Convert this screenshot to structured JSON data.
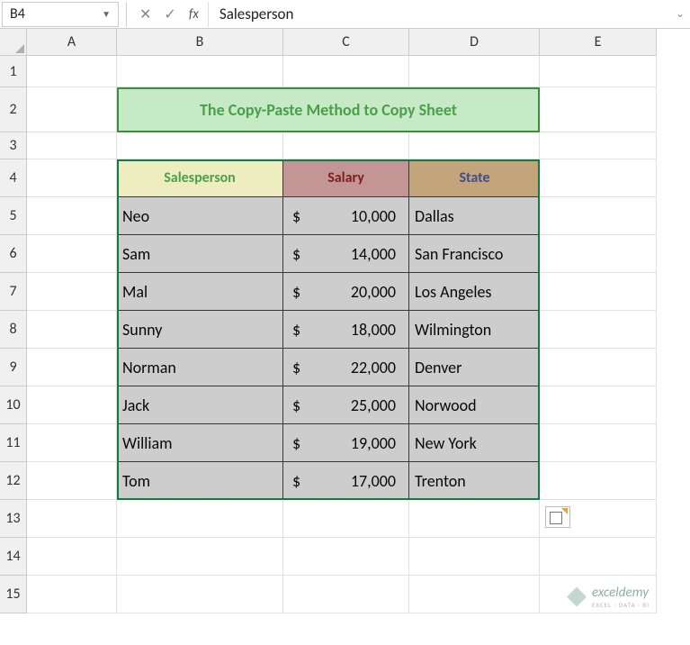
{
  "formula_bar": {
    "name_box": "B4",
    "formula_value": "Salesperson"
  },
  "columns": [
    "A",
    "B",
    "C",
    "D",
    "E"
  ],
  "rows": [
    "1",
    "2",
    "3",
    "4",
    "5",
    "6",
    "7",
    "8",
    "9",
    "10",
    "11",
    "12",
    "13",
    "14",
    "15"
  ],
  "title": "The Copy-Paste Method to Copy Sheet",
  "headers": {
    "salesperson": "Salesperson",
    "salary": "Salary",
    "state": "State"
  },
  "chart_data": {
    "type": "table",
    "columns": [
      "Salesperson",
      "Salary",
      "State"
    ],
    "rows": [
      {
        "salesperson": "Neo",
        "salary": 10000,
        "salary_display": "10,000",
        "state": "Dallas"
      },
      {
        "salesperson": "Sam",
        "salary": 14000,
        "salary_display": "14,000",
        "state": "San Francisco"
      },
      {
        "salesperson": "Mal",
        "salary": 20000,
        "salary_display": "20,000",
        "state": "Los Angeles"
      },
      {
        "salesperson": "Sunny",
        "salary": 18000,
        "salary_display": "18,000",
        "state": "Wilmington"
      },
      {
        "salesperson": "Norman",
        "salary": 22000,
        "salary_display": "22,000",
        "state": "Denver"
      },
      {
        "salesperson": "Jack",
        "salary": 25000,
        "salary_display": "25,000",
        "state": "Norwood"
      },
      {
        "salesperson": "William",
        "salary": 19000,
        "salary_display": "19,000",
        "state": "New York"
      },
      {
        "salesperson": "Tom",
        "salary": 17000,
        "salary_display": "17,000",
        "state": "Trenton"
      }
    ]
  },
  "currency": "$",
  "watermark": {
    "text": "exceldemy",
    "sub": "EXCEL · DATA · BI"
  }
}
